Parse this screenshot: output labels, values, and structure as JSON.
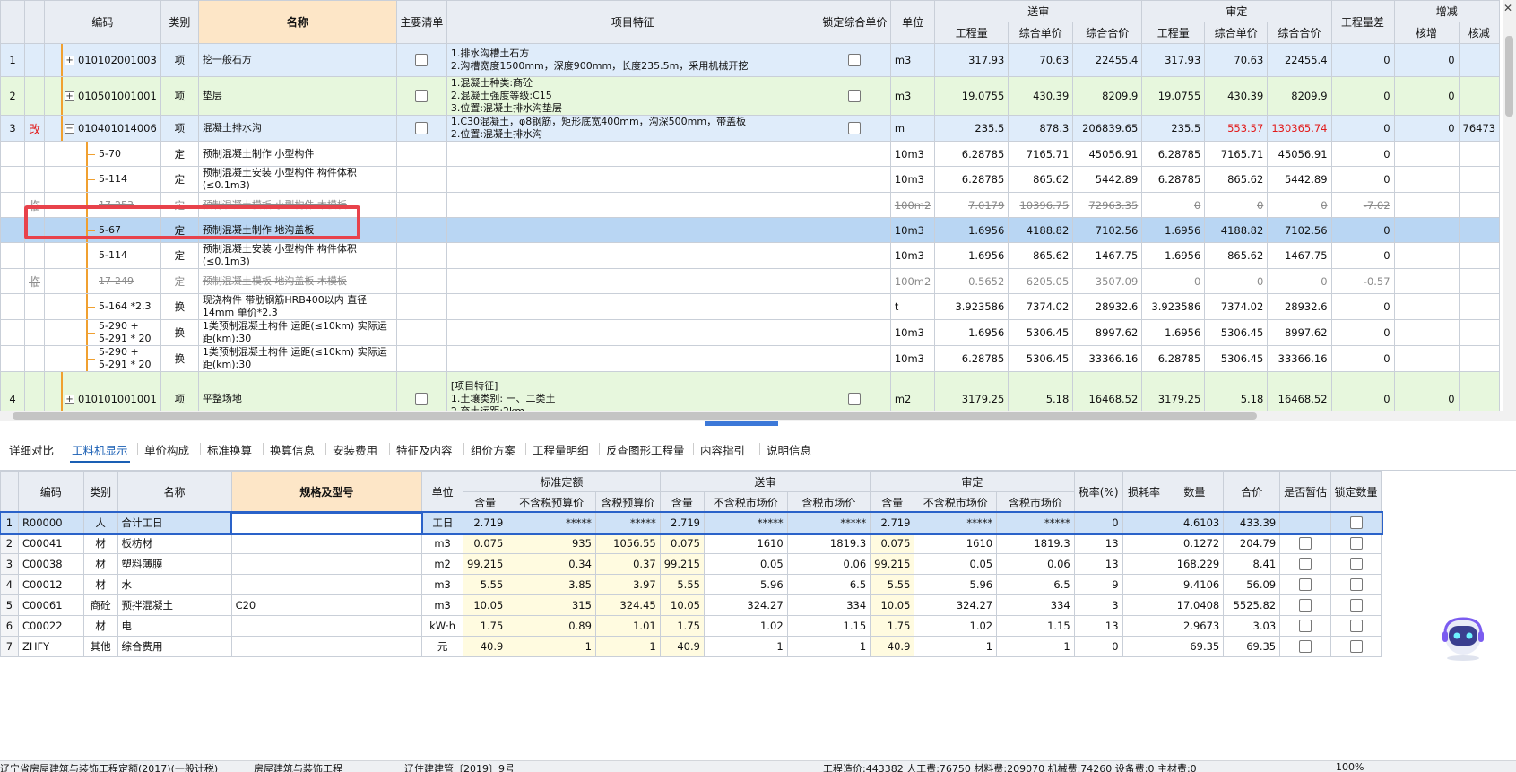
{
  "top_headers": {
    "code": "编码",
    "type": "类别",
    "name": "名称",
    "main_list": "主要清单",
    "features": "项目特征",
    "lock_price": "锁定综合单价",
    "unit": "单位",
    "submit_group": "送审",
    "review_group": "审定",
    "qty_diff": "工程量差",
    "change_group": "增减",
    "qty": "工程量",
    "unit_price": "综合单价",
    "total_price": "综合合价",
    "ch1": "核增",
    "ch2": "核减"
  },
  "top_rows": [
    {
      "idx": "1",
      "label": "",
      "code": "010102001003",
      "type": "项",
      "name": "挖一般石方",
      "features": "1.排水沟槽土石方\n2.沟槽宽度1500mm，深度900mm，长度235.5m，采用机械开挖",
      "unit": "m3",
      "sq": "317.93",
      "sp": "70.63",
      "st": "22455.4",
      "rq": "317.93",
      "rp": "70.63",
      "rt": "22455.4",
      "diff": "0",
      "inc": "0",
      "dec": ""
    },
    {
      "idx": "2",
      "label": "",
      "code": "010501001001",
      "type": "项",
      "name": "垫层",
      "features": "1.混凝土种类:商砼\n2.混凝土强度等级:C15\n3.位置:混凝土排水沟垫层",
      "unit": "m3",
      "sq": "19.0755",
      "sp": "430.39",
      "st": "8209.9",
      "rq": "19.0755",
      "rp": "430.39",
      "rt": "8209.9",
      "diff": "0",
      "inc": "0",
      "dec": ""
    },
    {
      "idx": "3",
      "label": "改",
      "code": "010401014006",
      "type": "项",
      "name": "混凝土排水沟",
      "features": "1.C30混凝土，φ8钢筋，矩形底宽400mm，沟深500mm，带盖板\n2.位置:混凝土排水沟",
      "unit": "m",
      "sq": "235.5",
      "sp": "878.3",
      "st": "206839.65",
      "rq": "235.5",
      "rp": "553.57",
      "rt": "130365.74",
      "diff": "0",
      "inc": "0",
      "dec": "76473"
    },
    {
      "idx": "",
      "label": "",
      "code": "5-70",
      "type": "定",
      "name": "预制混凝土制作 小型构件",
      "features": "",
      "unit": "10m3",
      "sq": "6.28785",
      "sp": "7165.71",
      "st": "45056.91",
      "rq": "6.28785",
      "rp": "7165.71",
      "rt": "45056.91",
      "diff": "0",
      "inc": "",
      "dec": ""
    },
    {
      "idx": "",
      "label": "",
      "code": "5-114",
      "type": "定",
      "name": "预制混凝土安装 小型构件 构件体积(≤0.1m3)",
      "features": "",
      "unit": "10m3",
      "sq": "6.28785",
      "sp": "865.62",
      "st": "5442.89",
      "rq": "6.28785",
      "rp": "865.62",
      "rt": "5442.89",
      "diff": "0",
      "inc": "",
      "dec": ""
    },
    {
      "idx": "",
      "label": "临",
      "code": "17-253",
      "type": "定",
      "name": "预制混凝土模板 小型构件 木模板",
      "features": "",
      "unit": "100m2",
      "sq": "7.0179",
      "sp": "10396.75",
      "st": "72963.35",
      "rq": "0",
      "rp": "0",
      "rt": "0",
      "diff": "-7.02",
      "inc": "",
      "dec": ""
    },
    {
      "idx": "",
      "label": "",
      "code": "5-67",
      "type": "定",
      "name": "预制混凝土制作 地沟盖板",
      "features": "",
      "unit": "10m3",
      "sq": "1.6956",
      "sp": "4188.82",
      "st": "7102.56",
      "rq": "1.6956",
      "rp": "4188.82",
      "rt": "7102.56",
      "diff": "0",
      "inc": "",
      "dec": ""
    },
    {
      "idx": "",
      "label": "",
      "code": "5-114",
      "type": "定",
      "name": "预制混凝土安装 小型构件 构件体积(≤0.1m3)",
      "features": "",
      "unit": "10m3",
      "sq": "1.6956",
      "sp": "865.62",
      "st": "1467.75",
      "rq": "1.6956",
      "rp": "865.62",
      "rt": "1467.75",
      "diff": "0",
      "inc": "",
      "dec": ""
    },
    {
      "idx": "",
      "label": "临",
      "code": "17-249",
      "type": "定",
      "name": "预制混凝土模板 地沟盖板 木模板",
      "features": "",
      "unit": "100m2",
      "sq": "0.5652",
      "sp": "6205.05",
      "st": "3507.09",
      "rq": "0",
      "rp": "0",
      "rt": "0",
      "diff": "-0.57",
      "inc": "",
      "dec": ""
    },
    {
      "idx": "",
      "label": "",
      "code": "5-164 *2.3",
      "type": "换",
      "name": "现浇构件 带肋钢筋HRB400以内 直径14mm 单价*2.3",
      "features": "",
      "unit": "t",
      "sq": "3.923586",
      "sp": "7374.02",
      "st": "28932.6",
      "rq": "3.923586",
      "rp": "7374.02",
      "rt": "28932.6",
      "diff": "0",
      "inc": "",
      "dec": ""
    },
    {
      "idx": "",
      "label": "",
      "code": "5-290 +\n5-291 * 20",
      "type": "换",
      "name": "1类预制混凝土构件 运距(≤10km) 实际运距(km):30",
      "features": "",
      "unit": "10m3",
      "sq": "1.6956",
      "sp": "5306.45",
      "st": "8997.62",
      "rq": "1.6956",
      "rp": "5306.45",
      "rt": "8997.62",
      "diff": "0",
      "inc": "",
      "dec": ""
    },
    {
      "idx": "",
      "label": "",
      "code": "5-290 +\n5-291 * 20",
      "type": "换",
      "name": "1类预制混凝土构件 运距(≤10km) 实际运距(km):30",
      "features": "",
      "unit": "10m3",
      "sq": "6.28785",
      "sp": "5306.45",
      "st": "33366.16",
      "rq": "6.28785",
      "rp": "5306.45",
      "rt": "33366.16",
      "diff": "0",
      "inc": "",
      "dec": ""
    },
    {
      "idx": "4",
      "label": "",
      "code": "010101001001",
      "type": "项",
      "name": "平整场地",
      "features": "[项目特征]\n1.土壤类别: 一、二类土\n2.弃土运距:2km",
      "unit": "m2",
      "sq": "3179.25",
      "sp": "5.18",
      "st": "16468.52",
      "rq": "3179.25",
      "rp": "5.18",
      "rt": "16468.52",
      "diff": "0",
      "inc": "0",
      "dec": ""
    }
  ],
  "tabs": [
    "详细对比",
    "工料机显示",
    "单价构成",
    "标准换算",
    "换算信息",
    "安装费用",
    "特征及内容",
    "组价方案",
    "工程量明细",
    "反查图形工程量",
    "内容指引",
    "说明信息"
  ],
  "active_tab": "工料机显示",
  "bot_headers": {
    "code": "编码",
    "type": "类别",
    "name": "名称",
    "spec": "规格及型号",
    "unit": "单位",
    "std_group": "标准定额",
    "submit_group": "送审",
    "review_group": "审定",
    "content": "含量",
    "notax_budget": "不含税预算价",
    "tax_budget": "含税预算价",
    "notax_market": "不含税市场价",
    "tax_market": "含税市场价",
    "tax_rate": "税率(%)",
    "loss": "损耗率",
    "qty": "数量",
    "total": "合价",
    "temp": "是否暂估",
    "lock_qty": "锁定数量"
  },
  "bot_rows": [
    {
      "n": "1",
      "code": "R00000",
      "type": "人",
      "name": "合计工日",
      "spec": "",
      "unit": "工日",
      "c1": "2.719",
      "p1": "*****",
      "p2": "*****",
      "c2": "2.719",
      "p3": "*****",
      "p4": "*****",
      "c3": "2.719",
      "p5": "*****",
      "p6": "*****",
      "tax": "0",
      "loss": "",
      "qty": "4.6103",
      "total": "433.39"
    },
    {
      "n": "2",
      "code": "C00041",
      "type": "材",
      "name": "板枋材",
      "spec": "",
      "unit": "m3",
      "c1": "0.075",
      "p1": "935",
      "p2": "1056.55",
      "c2": "0.075",
      "p3": "1610",
      "p4": "1819.3",
      "c3": "0.075",
      "p5": "1610",
      "p6": "1819.3",
      "tax": "13",
      "loss": "",
      "qty": "0.1272",
      "total": "204.79"
    },
    {
      "n": "3",
      "code": "C00038",
      "type": "材",
      "name": "塑料薄膜",
      "spec": "",
      "unit": "m2",
      "c1": "99.215",
      "p1": "0.34",
      "p2": "0.37",
      "c2": "99.215",
      "p3": "0.05",
      "p4": "0.06",
      "c3": "99.215",
      "p5": "0.05",
      "p6": "0.06",
      "tax": "13",
      "loss": "",
      "qty": "168.229",
      "total": "8.41"
    },
    {
      "n": "4",
      "code": "C00012",
      "type": "材",
      "name": "水",
      "spec": "",
      "unit": "m3",
      "c1": "5.55",
      "p1": "3.85",
      "p2": "3.97",
      "c2": "5.55",
      "p3": "5.96",
      "p4": "6.5",
      "c3": "5.55",
      "p5": "5.96",
      "p6": "6.5",
      "tax": "9",
      "loss": "",
      "qty": "9.4106",
      "total": "56.09"
    },
    {
      "n": "5",
      "code": "C00061",
      "type": "商砼",
      "name": "预拌混凝土",
      "spec": "C20",
      "unit": "m3",
      "c1": "10.05",
      "p1": "315",
      "p2": "324.45",
      "c2": "10.05",
      "p3": "324.27",
      "p4": "334",
      "c3": "10.05",
      "p5": "324.27",
      "p6": "334",
      "tax": "3",
      "loss": "",
      "qty": "17.0408",
      "total": "5525.82"
    },
    {
      "n": "6",
      "code": "C00022",
      "type": "材",
      "name": "电",
      "spec": "",
      "unit": "kW·h",
      "c1": "1.75",
      "p1": "0.89",
      "p2": "1.01",
      "c2": "1.75",
      "p3": "1.02",
      "p4": "1.15",
      "c3": "1.75",
      "p5": "1.02",
      "p6": "1.15",
      "tax": "13",
      "loss": "",
      "qty": "2.9673",
      "total": "3.03"
    },
    {
      "n": "7",
      "code": "ZHFY",
      "type": "其他",
      "name": "综合费用",
      "spec": "",
      "unit": "元",
      "c1": "40.9",
      "p1": "1",
      "p2": "1",
      "c2": "40.9",
      "p3": "1",
      "p4": "1",
      "c3": "40.9",
      "p5": "1",
      "p6": "1",
      "tax": "0",
      "loss": "",
      "qty": "69.35",
      "total": "69.35"
    }
  ],
  "status": {
    "quota": "辽宁省房屋建筑与装饰工程定额(2017)(一般计税)",
    "profession": "房屋建筑与装饰工程",
    "doc": "辽住建建管〔2019〕9号",
    "totals": "工程造价:443382  人工费:76750  材料费:209070  机械费:74260  设备费:0  主材费:0",
    "zoom": "100%"
  }
}
